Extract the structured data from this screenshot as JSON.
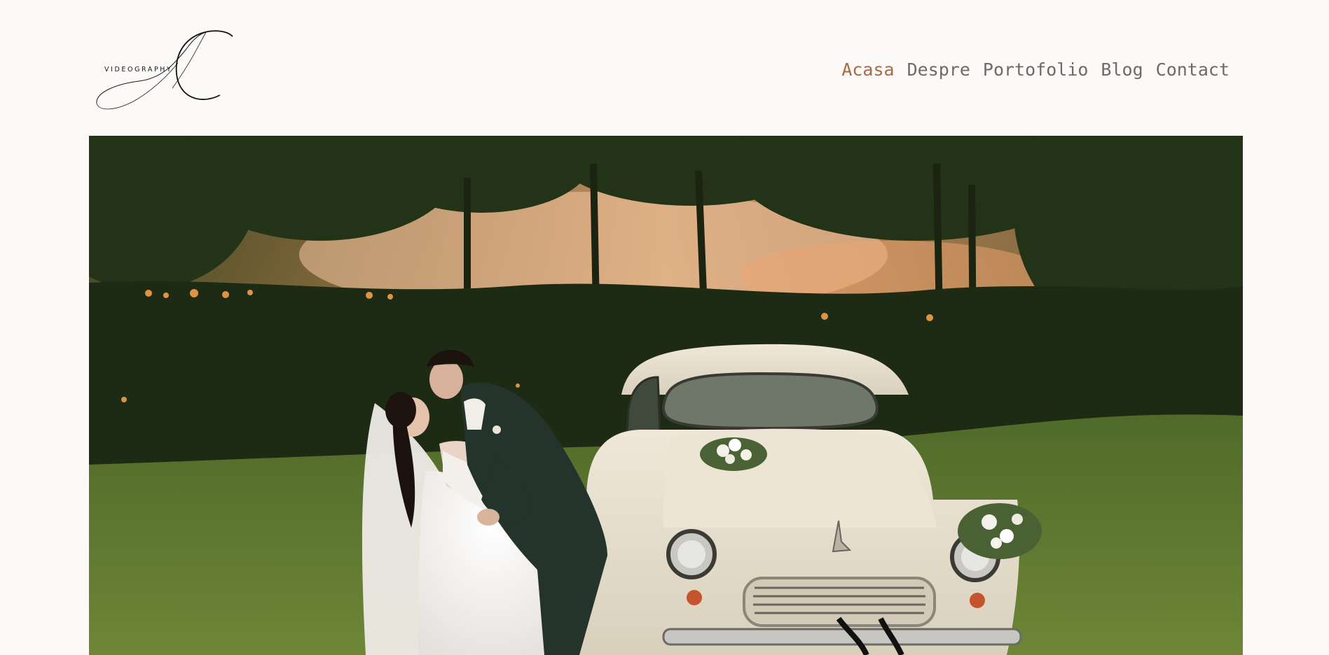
{
  "brand": {
    "logo_word": "VIDEOGRAPHY",
    "logo_icon": "ac-monogram-logo"
  },
  "nav": {
    "items": [
      {
        "label": "Acasa",
        "active": true
      },
      {
        "label": "Despre",
        "active": false
      },
      {
        "label": "Portofolio",
        "active": false
      },
      {
        "label": "Blog",
        "active": false
      },
      {
        "label": "Contact",
        "active": false
      }
    ]
  },
  "colors": {
    "background": "#fbfaf8",
    "nav_text": "#6f6a66",
    "nav_active": "#a76a45"
  },
  "hero": {
    "image": "wedding-couple-vintage-car-photo"
  }
}
